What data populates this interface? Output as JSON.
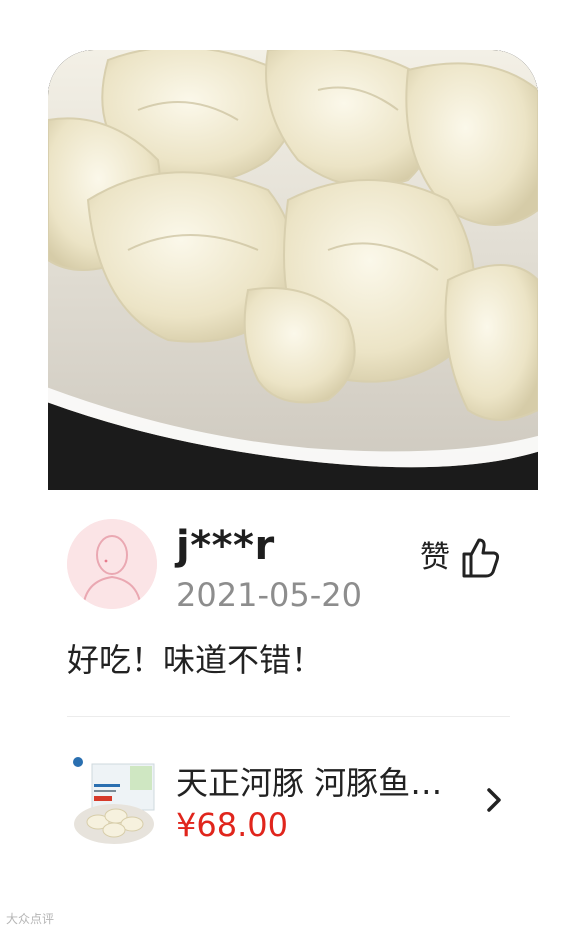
{
  "review": {
    "username": "j***r",
    "date": "2021-05-20",
    "like_label": "赞",
    "comment": "好吃！味道不错！"
  },
  "product": {
    "title": "天正河豚 河豚鱼水饺",
    "price": "¥68.00"
  },
  "watermark": "大众点评",
  "icons": {
    "like": "thumbs-up-icon",
    "chevron": "chevron-right-icon",
    "avatar": "default-avatar-icon"
  },
  "colors": {
    "price": "#e0251c",
    "date": "#8d8d8d",
    "avatar_bg": "#fbe4e6"
  }
}
